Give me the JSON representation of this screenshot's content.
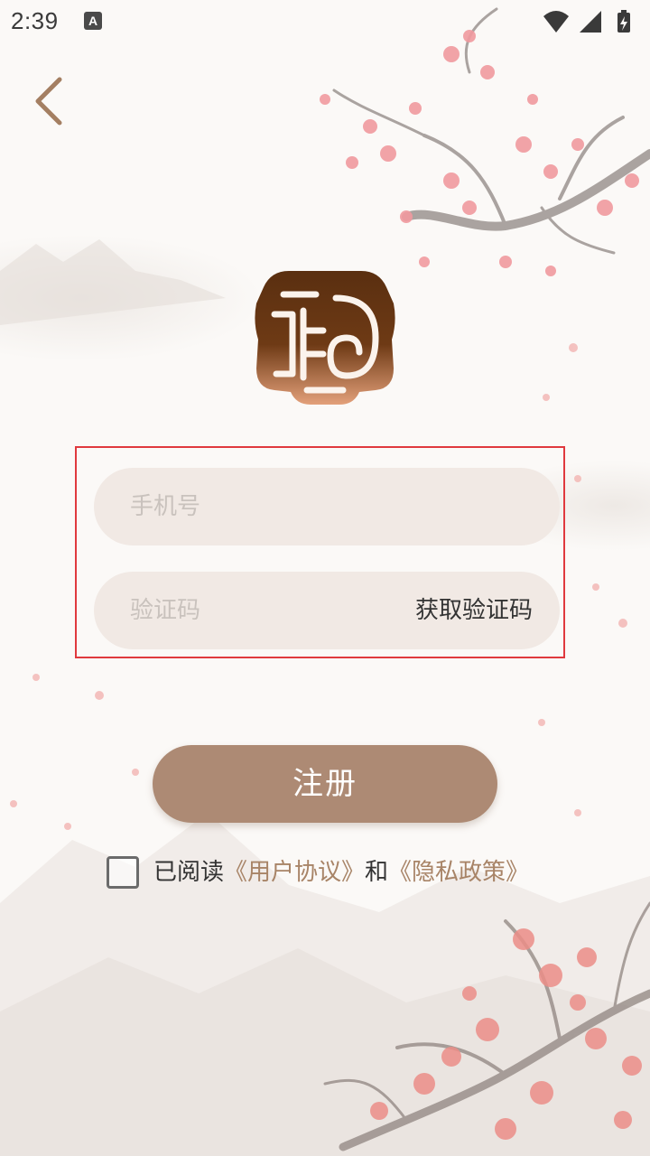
{
  "status_bar": {
    "time": "2:39",
    "notification_icon": "a-icon",
    "icons": [
      "wifi-icon",
      "cellular-icon",
      "battery-charging-icon"
    ]
  },
  "nav": {
    "back_icon": "chevron-left-icon"
  },
  "logo": {
    "icon": "seal-logo"
  },
  "form": {
    "phone_placeholder": "手机号",
    "code_placeholder": "验证码",
    "get_code_label": "获取验证码"
  },
  "register": {
    "label": "注册"
  },
  "agreement": {
    "prefix": "已阅读",
    "user_agreement": "《用户协议》",
    "and": "和",
    "privacy_policy": "《隐私政策》",
    "checked": false
  },
  "colors": {
    "accent_brown": "#ad8a74",
    "link_brown": "#a88467",
    "field_bg": "#f1e9e4",
    "highlight_red": "#e0393e",
    "logo_dark": "#5a2f10",
    "logo_light": "#e3a07a"
  }
}
